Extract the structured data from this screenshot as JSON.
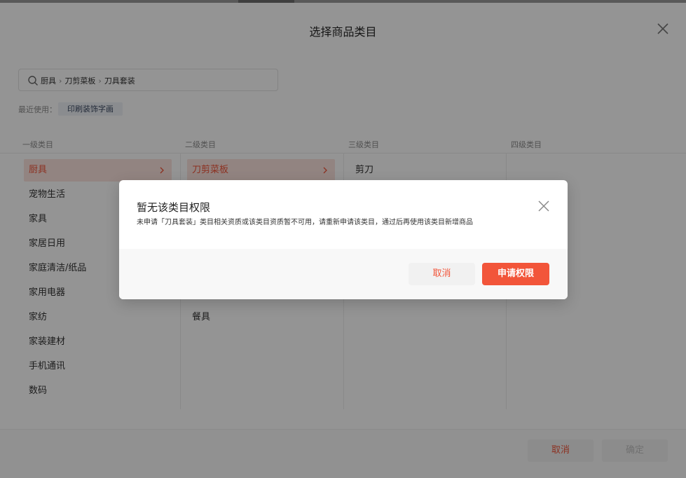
{
  "dialog": {
    "title": "选择商品类目",
    "close_icon": "close-icon"
  },
  "search": {
    "icon": "search-icon",
    "breadcrumb": [
      "厨具",
      "刀剪菜板",
      "刀具套装"
    ]
  },
  "recent": {
    "label": "最近使用：",
    "items": [
      "印刷装饰字画"
    ]
  },
  "columns": {
    "headers": [
      "一级类目",
      "二级类目",
      "三级类目",
      "四级类目"
    ],
    "level1": [
      {
        "label": "厨具",
        "active": true
      },
      {
        "label": "宠物生活"
      },
      {
        "label": "家具"
      },
      {
        "label": "家居日用"
      },
      {
        "label": "家庭清洁/纸品"
      },
      {
        "label": "家用电器"
      },
      {
        "label": "家纺"
      },
      {
        "label": "家装建材"
      },
      {
        "label": "手机通讯"
      },
      {
        "label": "数码"
      }
    ],
    "level2": [
      {
        "label": "刀剪菜板",
        "active": true
      },
      {
        "label": ""
      },
      {
        "label": ""
      },
      {
        "label": ""
      },
      {
        "label": ""
      },
      {
        "label": ""
      },
      {
        "label": "餐具"
      }
    ],
    "level3": [
      {
        "label": "剪刀"
      }
    ]
  },
  "footer": {
    "cancel_label": "取消",
    "confirm_label": "确定"
  },
  "modal": {
    "title": "暂无该类目权限",
    "description": "未申请「刀具套装」类目相关资质或该类目资质暂不可用，请重新申请该类目，通过后再使用该类目新增商品",
    "cancel_label": "取消",
    "apply_label": "申请权限"
  },
  "colors": {
    "accent": "#f2553a",
    "active_bg": "#fbe3df",
    "mask": "rgba(0,0,0,0.42)"
  }
}
